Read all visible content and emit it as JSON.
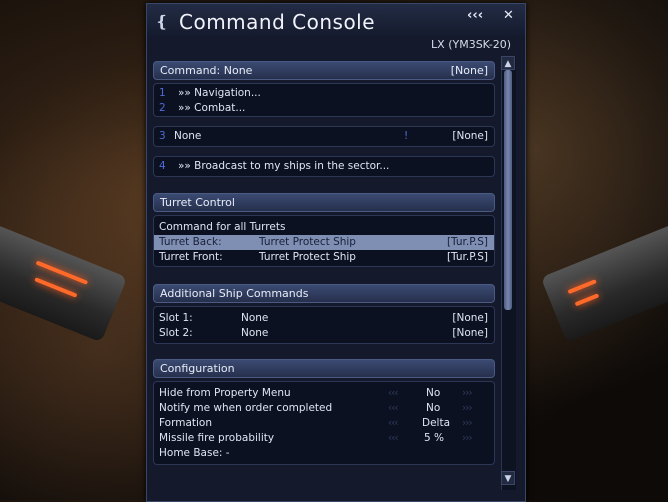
{
  "window": {
    "title": "Command Console",
    "subtitle": "LX  (YM3SK-20)",
    "collapse_label": "‹‹‹",
    "close_label": "✕"
  },
  "command": {
    "header": "Command:  None",
    "header_status": "[None]",
    "options": [
      {
        "num": "1",
        "label": "»» Navigation..."
      },
      {
        "num": "2",
        "label": "»» Combat..."
      }
    ],
    "slot3": {
      "num": "3",
      "label": "None",
      "marker": "!",
      "status": "[None]"
    },
    "slot4": {
      "num": "4",
      "label": "»» Broadcast to my ships in the sector..."
    }
  },
  "turret": {
    "header": "Turret Control",
    "all_label": "Command for all Turrets",
    "rows": [
      {
        "name": "Turret Back:",
        "command": "Turret Protect Ship",
        "short": "[Tur.P.S]"
      },
      {
        "name": "Turret Front:",
        "command": "Turret Protect Ship",
        "short": "[Tur.P.S]"
      }
    ]
  },
  "additional": {
    "header": "Additional Ship Commands",
    "rows": [
      {
        "name": "Slot 1:",
        "value": "None",
        "status": "[None]"
      },
      {
        "name": "Slot 2:",
        "value": "None",
        "status": "[None]"
      }
    ]
  },
  "config": {
    "header": "Configuration",
    "left_arrows": "‹‹‹",
    "right_arrows": "›››",
    "rows": [
      {
        "name": "Hide from Property Menu",
        "value": "No"
      },
      {
        "name": "Notify me when order completed",
        "value": "No"
      },
      {
        "name": "Formation",
        "value": "Delta"
      },
      {
        "name": "Missile fire probability",
        "value": "5 %"
      },
      {
        "name": "Home Base: -",
        "value": ""
      }
    ]
  },
  "scroll": {
    "up_label": "▲",
    "down_label": "▼"
  },
  "colors": {
    "accent": "#4f6ad4",
    "selected_row": "#7f8fb4",
    "panel": "#0c1121"
  }
}
